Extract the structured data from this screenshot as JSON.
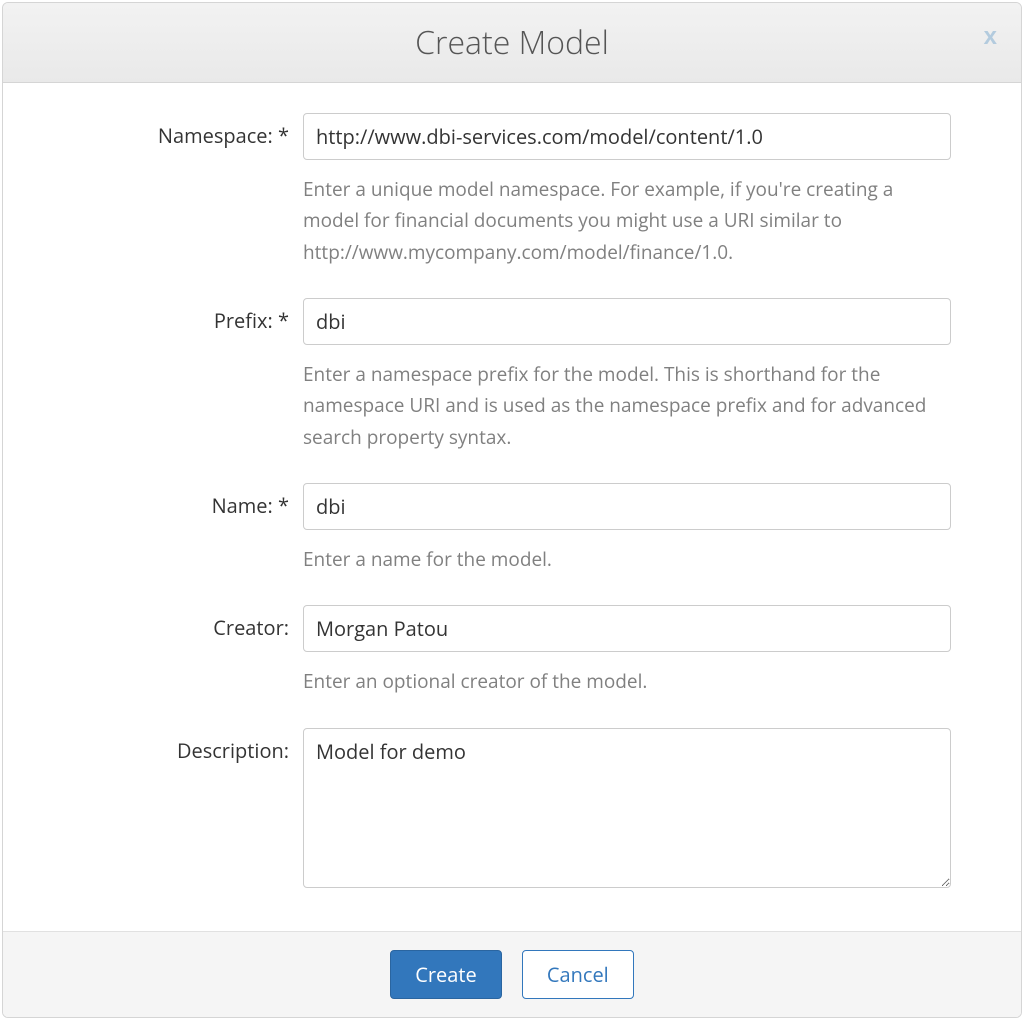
{
  "dialog": {
    "title": "Create Model",
    "close_label": "x"
  },
  "form": {
    "namespace": {
      "label": "Namespace: *",
      "value": "http://www.dbi-services.com/model/content/1.0",
      "help": "Enter a unique model namespace. For example, if you're creating a model for financial documents you might use a URI similar to http://www.mycompany.com/model/finance/1.0."
    },
    "prefix": {
      "label": "Prefix: *",
      "value": "dbi",
      "help": "Enter a namespace prefix for the model. This is shorthand for the namespace URI and is used as the namespace prefix and for advanced search property syntax."
    },
    "name": {
      "label": "Name: *",
      "value": "dbi",
      "help": "Enter a name for the model."
    },
    "creator": {
      "label": "Creator:",
      "value": "Morgan Patou",
      "help": "Enter an optional creator of the model."
    },
    "description": {
      "label": "Description:",
      "value": "Model for demo"
    }
  },
  "footer": {
    "create_label": "Create",
    "cancel_label": "Cancel"
  }
}
